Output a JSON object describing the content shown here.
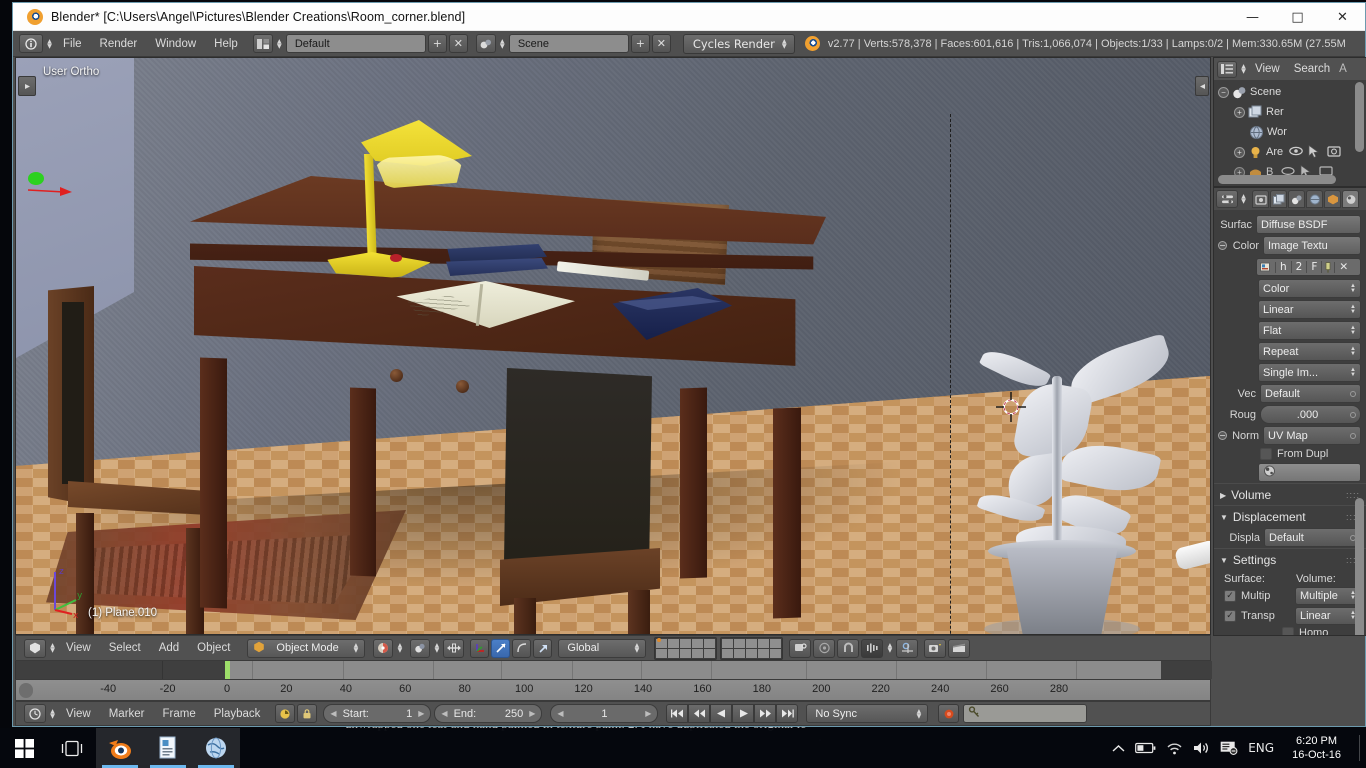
{
  "window": {
    "title": "Blender* [C:\\Users\\Angel\\Pictures\\Blender Creations\\Room_corner.blend]",
    "logo": "blender-logo",
    "controls": {
      "minimize": "—",
      "maximize": "□",
      "close": "✕"
    }
  },
  "background": {
    "page_text": "unwrapped one leaf and hand painted in texture paint. 2. I have duplicated the original le"
  },
  "topbar": {
    "editor_type_icon": "info-editor-icon",
    "menus": [
      "File",
      "Render",
      "Window",
      "Help"
    ],
    "screen_layout": {
      "icon": "screen-layout-icon",
      "value": "Default",
      "add": "+",
      "remove": "✕"
    },
    "scene": {
      "icon": "scene-icon",
      "value": "Scene",
      "add": "+",
      "remove": "✕"
    },
    "engine": {
      "value": "Cycles Render"
    },
    "stats": "v2.77 | Verts:578,378 | Faces:601,616 | Tris:1,066,074 | Objects:1/33 | Lamps:0/2 | Mem:330.65M (27.55M"
  },
  "viewport": {
    "view_label": "User Ortho",
    "active_object_label": "(1) Plane.010",
    "axis_gizmo": {
      "z": "z",
      "y": "y",
      "x": "x"
    },
    "header": {
      "editor_icon": "3d-view-editor-icon",
      "menus": [
        "View",
        "Select",
        "Add",
        "Object"
      ],
      "mode": {
        "icon": "object-mode-icon",
        "value": "Object Mode"
      },
      "viewport_shading": "shading-icon",
      "pivot": "pivot-icon",
      "manipulator_toggle": "manipulator-icon",
      "transform_translate": "translate-gizmo-icon",
      "transform_rotate": "rotate-gizmo-icon",
      "transform_scale": "scale-gizmo-icon",
      "orientation": "Global",
      "layers_label": "scene-layers",
      "proportional": "proportional-edit-icon",
      "snap": "snap-magnet-icon",
      "render_preview": "render-preview-icon",
      "opengl_render": "opengl-render-icon"
    }
  },
  "timeline": {
    "ruler_ticks": [
      -40,
      -20,
      0,
      20,
      40,
      60,
      80,
      100,
      120,
      140,
      160,
      180,
      200,
      220,
      240,
      260,
      280
    ],
    "playhead_frame": 0,
    "header": {
      "editor_icon": "timeline-editor-icon",
      "menus": [
        "View",
        "Marker",
        "Frame",
        "Playback"
      ],
      "auto_keyframe_icon": "auto-keyframe-icon",
      "lock_icon": "lock-icon",
      "start": {
        "label": "Start:",
        "value": "1"
      },
      "end": {
        "label": "End:",
        "value": "250"
      },
      "current_frame": "1",
      "buttons": [
        "jump-start",
        "prev-keyframe",
        "play-reverse",
        "play",
        "next-keyframe",
        "jump-end"
      ],
      "sync_mode": "No Sync",
      "record_icon": "record-icon",
      "keying_set_icon": "keying-set-icon"
    }
  },
  "outliner": {
    "header": {
      "editor_icon": "outliner-editor-icon",
      "menus": [
        "View",
        "Search"
      ],
      "overflow": "A"
    },
    "rows": [
      {
        "expander": "−",
        "icon": "scene-icon",
        "label": "Scene",
        "indent": 0,
        "extra": []
      },
      {
        "expander": "+",
        "icon": "render-layers-icon",
        "label": "Rer",
        "indent": 1,
        "extra": []
      },
      {
        "expander": "",
        "icon": "world-icon",
        "label": "Wor",
        "indent": 1,
        "extra": []
      },
      {
        "expander": "+",
        "icon": "lamp-icon",
        "label": "Are",
        "indent": 1,
        "extra": [
          "eye-icon",
          "cursor-icon",
          "camera-icon"
        ]
      },
      {
        "expander": "+",
        "icon": "mesh-icon",
        "label": "B",
        "indent": 1,
        "extra": [
          "eye-icon",
          "cursor-icon",
          "camera-icon"
        ]
      }
    ]
  },
  "properties": {
    "tabs": [
      {
        "name": "render",
        "icon": "camera-back-icon",
        "active": false
      },
      {
        "name": "render-layers",
        "icon": "render-layers-icon",
        "active": false
      },
      {
        "name": "scene",
        "icon": "scene-icon",
        "active": false
      },
      {
        "name": "world",
        "icon": "world-icon",
        "active": false
      },
      {
        "name": "object",
        "icon": "object-cube-icon",
        "active": false
      },
      {
        "name": "material",
        "icon": "material-sphere-icon",
        "active": true
      }
    ],
    "surface": {
      "label": "Surfac",
      "value": "Diffuse BSDF"
    },
    "color": {
      "label": "Color",
      "value": "Image Textu",
      "texture_row": [
        "image-browse-icon",
        "h",
        "2",
        "F",
        "pin-icon",
        "✕"
      ],
      "color_space": "Color",
      "interpolation": "Linear",
      "projection": "Flat",
      "extension": "Repeat",
      "source": "Single Im..."
    },
    "vector": {
      "label": "Vec",
      "value": "Default"
    },
    "roughness": {
      "label": "Roug",
      "value": ".000"
    },
    "normal": {
      "label": "Norm",
      "value": "UV Map"
    },
    "from_dupli": {
      "label": "From Dupl",
      "checked": false
    },
    "volume_panel": {
      "label": "Volume",
      "open": false
    },
    "displacement_panel": {
      "label": "Displacement",
      "open": true,
      "field_label": "Displa",
      "field_value": "Default"
    },
    "settings_panel": {
      "label": "Settings",
      "open": true,
      "surface_label": "Surface:",
      "volume_label": "Volume:",
      "multiple_importance": {
        "label": "Multip",
        "checked": true
      },
      "transparent_shadows": {
        "label": "Transp",
        "checked": true
      },
      "volume_sampling": "Multiple",
      "volume_interpolation": "Linear",
      "homogeneous": {
        "label": "Homo",
        "checked": false
      }
    }
  },
  "taskbar": {
    "items": [
      {
        "name": "start-button",
        "icon": "windows-logo-icon"
      },
      {
        "name": "task-view-button",
        "icon": "task-view-icon"
      },
      {
        "name": "blender-taskbar-item",
        "icon": "blender-logo-icon",
        "active": true
      },
      {
        "name": "text-editor-taskbar-item",
        "icon": "document-icon",
        "active": true
      },
      {
        "name": "browser-taskbar-item",
        "icon": "globe-icon",
        "active": true
      }
    ],
    "tray": [
      "chevron-up-icon",
      "battery-icon",
      "wifi-icon",
      "volume-icon",
      "action-center-icon"
    ],
    "language": "ENG",
    "clock": {
      "time": "6:20 PM",
      "date": "16-Oct-16"
    }
  }
}
